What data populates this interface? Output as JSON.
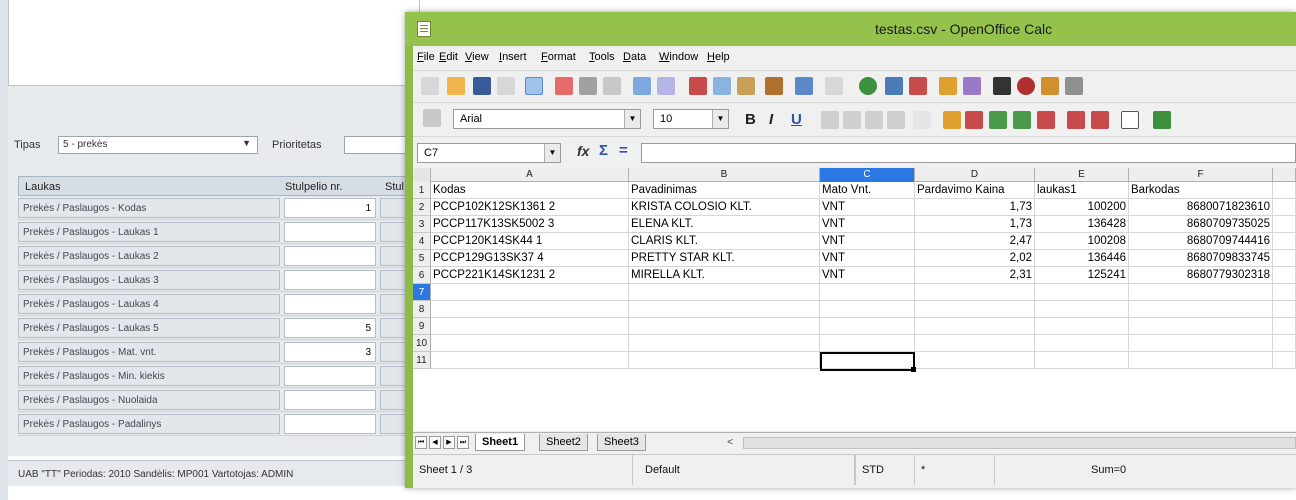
{
  "background_app": {
    "tipas_label": "Tipas",
    "tipas_value": "5 - prekės",
    "tipas_arrow": "▼",
    "prioritetas_label": "Prioritetas",
    "grid_headers": [
      "Laukas",
      "Stulpelio nr.",
      "Stul"
    ],
    "rows": [
      {
        "label": "Prekės / Paslaugos - Kodas",
        "value": "1"
      },
      {
        "label": "Prekės / Paslaugos - Laukas 1",
        "value": ""
      },
      {
        "label": "Prekės / Paslaugos - Laukas 2",
        "value": ""
      },
      {
        "label": "Prekės / Paslaugos - Laukas 3",
        "value": ""
      },
      {
        "label": "Prekės / Paslaugos - Laukas 4",
        "value": ""
      },
      {
        "label": "Prekės / Paslaugos - Laukas 5",
        "value": "5"
      },
      {
        "label": "Prekės / Paslaugos - Mat. vnt.",
        "value": "3"
      },
      {
        "label": "Prekės / Paslaugos - Min. kiekis",
        "value": ""
      },
      {
        "label": "Prekės / Paslaugos - Nuolaida",
        "value": ""
      },
      {
        "label": "Prekės / Paslaugos - Padalinys",
        "value": ""
      }
    ],
    "status": "UAB \"TT\" Periodas: 2010   Sandėlis: MP001   Vartotojas: ADMIN"
  },
  "window": {
    "title": "testas.csv - OpenOffice Calc",
    "menu": [
      {
        "u": "F",
        "rest": "ile"
      },
      {
        "u": "E",
        "rest": "dit"
      },
      {
        "u": "V",
        "rest": "iew"
      },
      {
        "u": "I",
        "rest": "nsert"
      },
      {
        "u": "F",
        "rest": "ormat"
      },
      {
        "u": "T",
        "rest": "ools"
      },
      {
        "u": "D",
        "rest": "ata"
      },
      {
        "u": "W",
        "rest": "indow"
      },
      {
        "u": "H",
        "rest": "elp"
      }
    ],
    "font_name": "Arial",
    "font_size": "10",
    "cell_ref": "C7",
    "bold_glyph": "B",
    "italic_glyph": "I",
    "underline_glyph": "U",
    "fx_glyph": "fx",
    "sigma_glyph": "Σ",
    "equals_glyph": "=",
    "dropdown_glyph": "▼"
  },
  "sheet": {
    "columns": [
      "A",
      "B",
      "C",
      "D",
      "E",
      "F"
    ],
    "active_column": "C",
    "active_row": "7",
    "row_numbers": [
      "1",
      "2",
      "3",
      "4",
      "5",
      "6",
      "7",
      "8",
      "9",
      "10",
      "11"
    ],
    "rows": [
      [
        "Kodas",
        "Pavadinimas",
        "Mato Vnt.",
        "Pardavimo Kaina",
        "laukas1",
        "Barkodas"
      ],
      [
        "PCCP102K12SK1361 2",
        "KRISTA COLOSIO KLT.",
        "VNT",
        "1,73",
        "100200",
        "8680071823610"
      ],
      [
        "PCCP117K13SK5002 3",
        "ELENA KLT.",
        "VNT",
        "1,73",
        "136428",
        "8680709735025"
      ],
      [
        "PCCP120K14SK44 1",
        "CLARIS KLT.",
        "VNT",
        "2,47",
        "100208",
        "8680709744416"
      ],
      [
        "PCCP129G13SK37 4",
        "PRETTY STAR KLT.",
        "VNT",
        "2,02",
        "136446",
        "8680709833745"
      ],
      [
        "PCCP221K14SK1231 2",
        "MIRELLA KLT.",
        "VNT",
        "2,31",
        "125241",
        "8680779302318"
      ]
    ],
    "tabs": [
      "Sheet1",
      "Sheet2",
      "Sheet3"
    ],
    "active_tab": "Sheet1",
    "tab_nav": [
      "⏮",
      "◀",
      "▶",
      "⏭"
    ],
    "scroll_left": "<"
  },
  "statusbar": {
    "sheet": "Sheet 1 / 3",
    "style": "Default",
    "mode": "STD",
    "star": "*",
    "sum": "Sum=0"
  }
}
